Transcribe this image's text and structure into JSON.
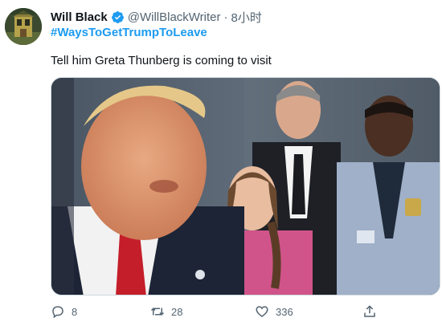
{
  "tweet": {
    "author_name": "Will Black",
    "handle": "@WillBlackWriter",
    "separator": "·",
    "time": "8小时",
    "hashtag": "#WaysToGetTrumpToLeave",
    "text": "Tell him Greta Thunberg is coming to visit",
    "verified": true
  },
  "actions": {
    "reply_count": "8",
    "retweet_count": "28",
    "like_count": "336",
    "share_icon": "share-icon"
  },
  "colors": {
    "link": "#1d9bf0",
    "secondary_text": "#536471",
    "verified_badge": "#1d9bf0"
  }
}
